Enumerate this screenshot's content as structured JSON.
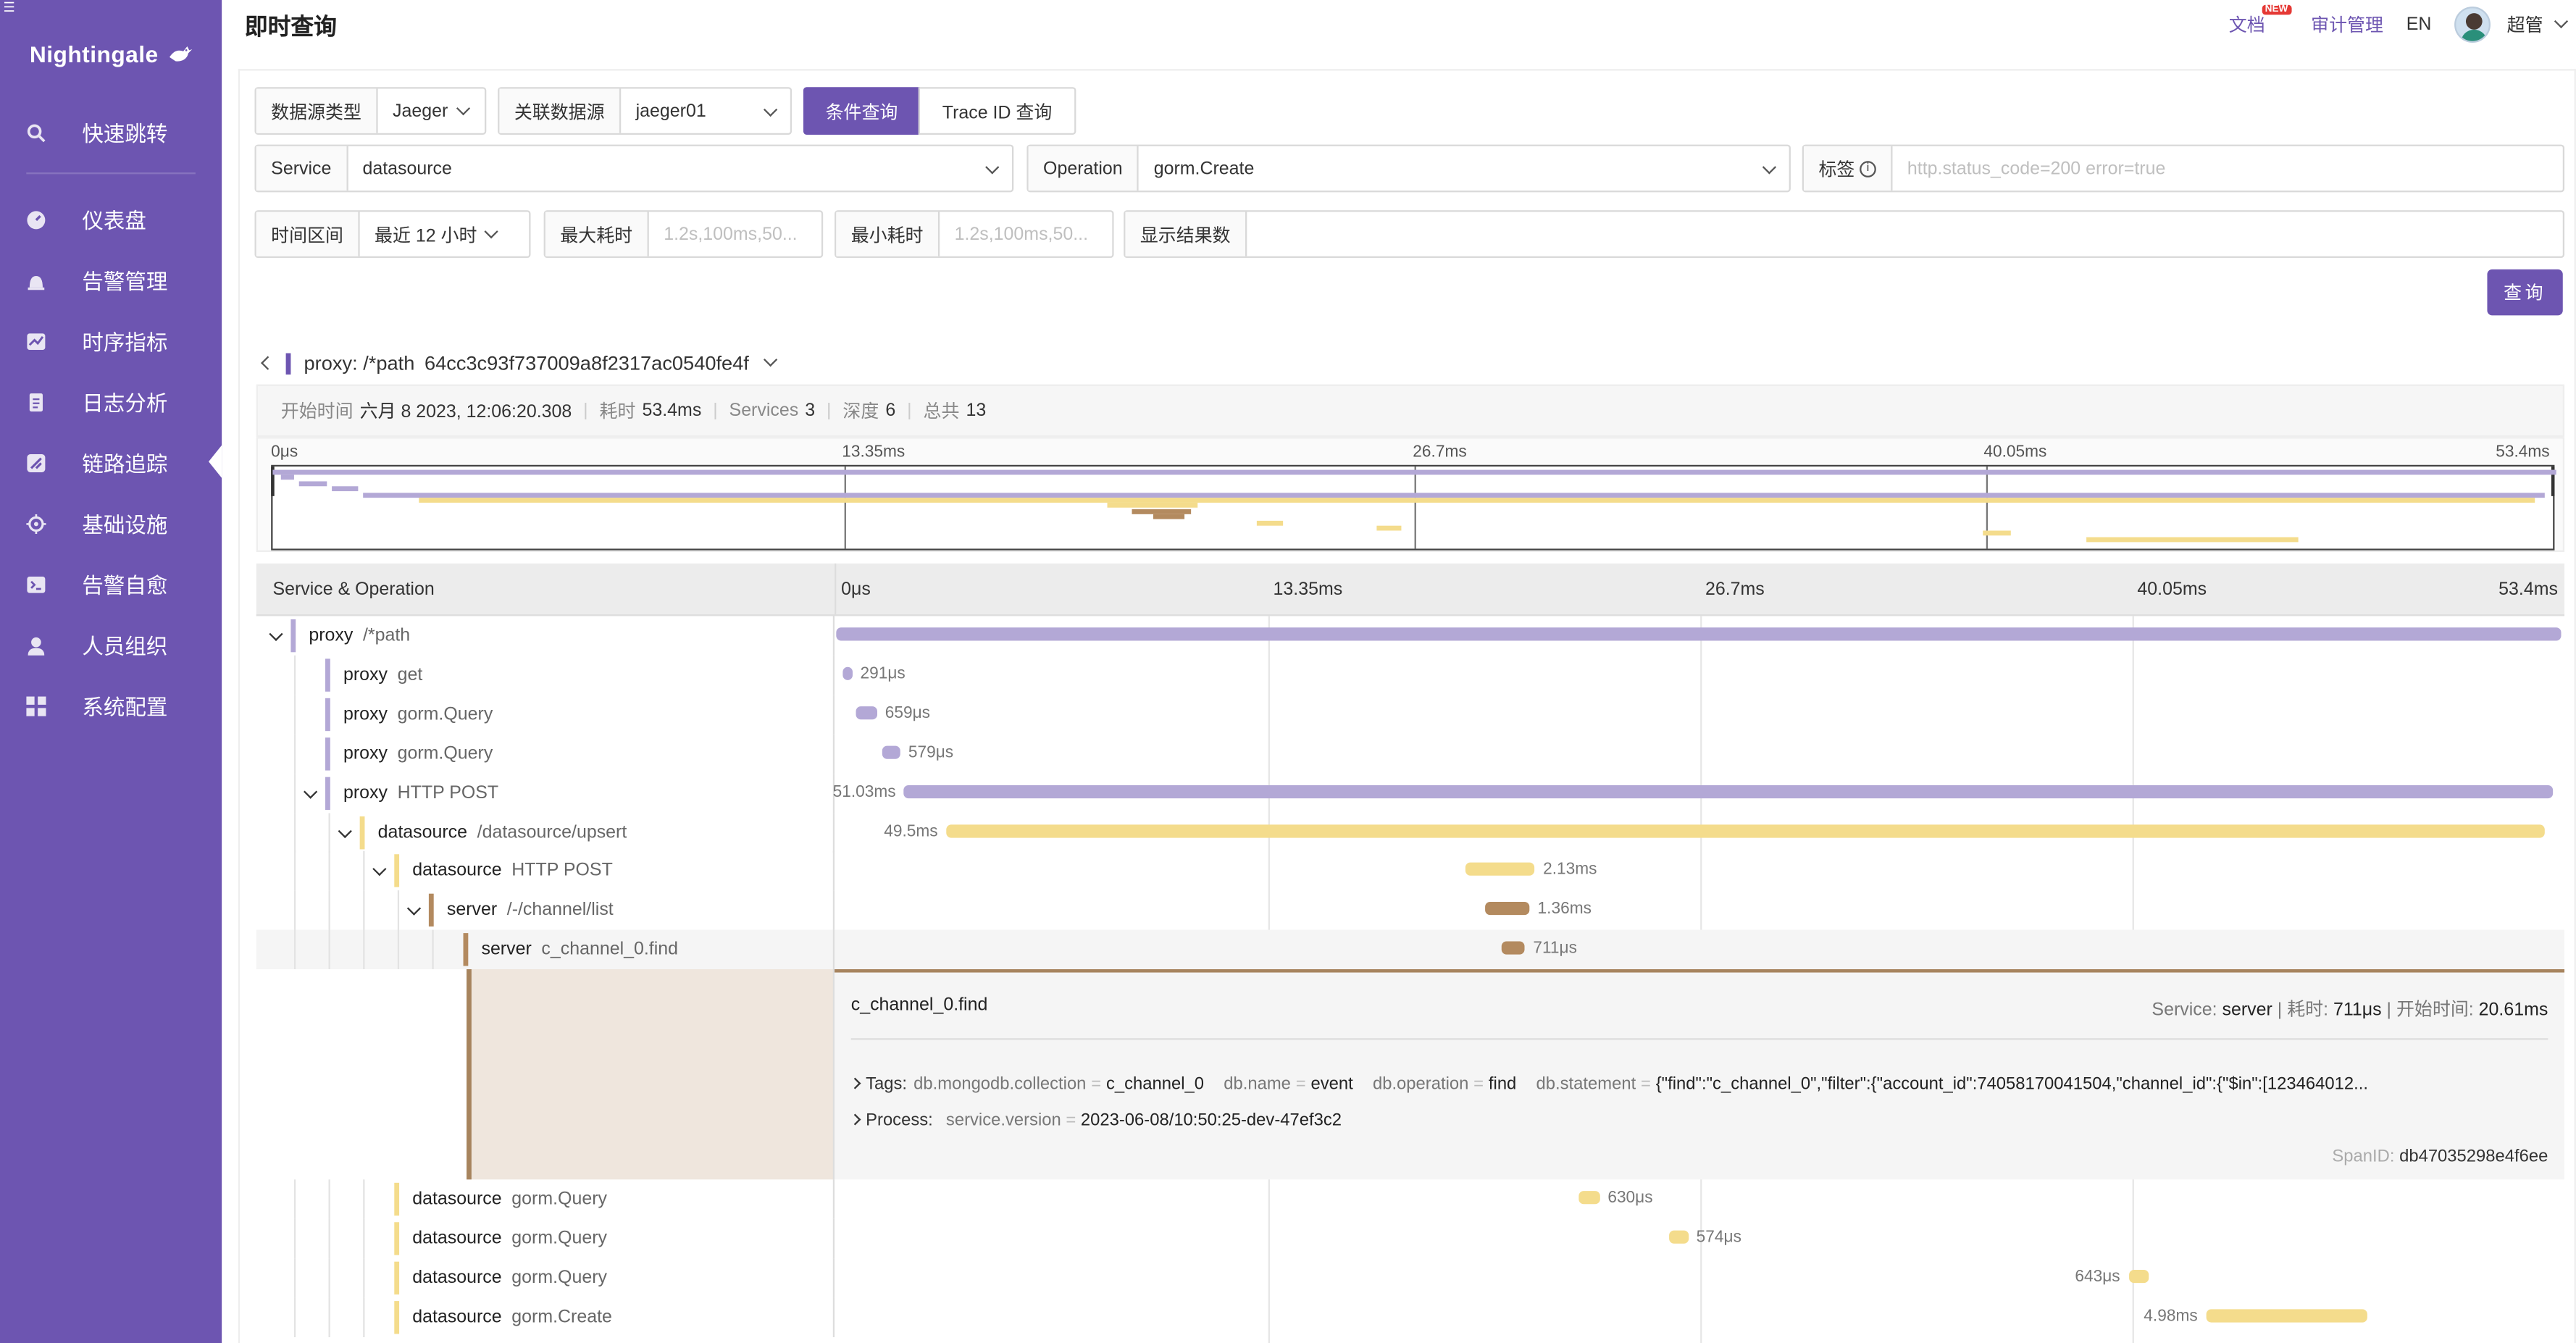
{
  "sidebar": {
    "logo": "Nightingale",
    "items": [
      {
        "label": "快速跳转",
        "icon": "search-icon"
      },
      {
        "label": "仪表盘",
        "icon": "dashboard-icon"
      },
      {
        "label": "告警管理",
        "icon": "alarm-icon"
      },
      {
        "label": "时序指标",
        "icon": "line-chart-icon"
      },
      {
        "label": "日志分析",
        "icon": "document-icon"
      },
      {
        "label": "链路追踪",
        "icon": "trace-icon",
        "active": true
      },
      {
        "label": "基础设施",
        "icon": "crosshair-icon"
      },
      {
        "label": "告警自愈",
        "icon": "terminal-icon"
      },
      {
        "label": "人员组织",
        "icon": "user-icon"
      },
      {
        "label": "系统配置",
        "icon": "grid-icon"
      }
    ]
  },
  "header": {
    "title": "即时查询",
    "docs": "文档",
    "new_badge": "NEW",
    "audit": "审计管理",
    "lang": "EN",
    "user": "超管"
  },
  "filters": {
    "datasource_type_label": "数据源类型",
    "datasource_type_value": "Jaeger",
    "datasource_label": "关联数据源",
    "datasource_value": "jaeger01",
    "tab_condition": "条件查询",
    "tab_traceid": "Trace ID 查询",
    "service_label": "Service",
    "service_value": "datasource",
    "operation_label": "Operation",
    "operation_value": "gorm.Create",
    "tags_label": "标签",
    "tags_placeholder": "http.status_code=200 error=true",
    "time_label": "时间区间",
    "time_value": "最近 12 小时",
    "max_label": "最大耗时",
    "max_placeholder": "1.2s,100ms,50...",
    "min_label": "最小耗时",
    "min_placeholder": "1.2s,100ms,50...",
    "limit_label": "显示结果数",
    "limit_value": "",
    "query_button": "查询"
  },
  "trace": {
    "title": "proxy: /*path",
    "id": "64cc3c93f737009a8f2317ac0540fe4f",
    "start_label": "开始时间",
    "start_value": "六月 8 2023, 12:06:20.308",
    "duration_label": "耗时",
    "duration_value": "53.4ms",
    "services_label": "Services",
    "services_value": "3",
    "depth_label": "深度",
    "depth_value": "6",
    "spans_label": "总共",
    "spans_value": "13",
    "ticks": [
      "0μs",
      "13.35ms",
      "26.7ms",
      "40.05ms",
      "53.4ms"
    ],
    "column_header": "Service & Operation",
    "colors": {
      "proxy": "#b3a8d6",
      "datasource": "#f4dc8c",
      "server": "#b38a5f"
    }
  },
  "spans": [
    {
      "service": "proxy",
      "operation": "/*path",
      "start_ms": 0,
      "duration_ms": 53.4,
      "duration_label": "",
      "depth": 0,
      "expanded": true
    },
    {
      "service": "proxy",
      "operation": "get",
      "start_ms": 0.2,
      "duration_ms": 0.291,
      "duration_label": "291μs",
      "depth": 1
    },
    {
      "service": "proxy",
      "operation": "gorm.Query",
      "start_ms": 0.6,
      "duration_ms": 0.659,
      "duration_label": "659μs",
      "depth": 1
    },
    {
      "service": "proxy",
      "operation": "gorm.Query",
      "start_ms": 1.4,
      "duration_ms": 0.579,
      "duration_label": "579μs",
      "depth": 1
    },
    {
      "service": "proxy",
      "operation": "HTTP POST",
      "start_ms": 2.1,
      "duration_ms": 51.03,
      "duration_label": "51.03ms",
      "depth": 1,
      "expanded": true
    },
    {
      "service": "datasource",
      "operation": "/datasource/upsert",
      "start_ms": 3.4,
      "duration_ms": 49.5,
      "duration_label": "49.5ms",
      "depth": 2,
      "expanded": true
    },
    {
      "service": "datasource",
      "operation": "HTTP POST",
      "start_ms": 19.5,
      "duration_ms": 2.13,
      "duration_label": "2.13ms",
      "depth": 3,
      "expanded": true
    },
    {
      "service": "server",
      "operation": "/-/channel/list",
      "start_ms": 20.1,
      "duration_ms": 1.36,
      "duration_label": "1.36ms",
      "depth": 4,
      "expanded": true
    },
    {
      "service": "server",
      "operation": "c_channel_0.find",
      "start_ms": 20.61,
      "duration_ms": 0.711,
      "duration_label": "711μs",
      "depth": 5,
      "selected": true
    },
    {
      "service": "datasource",
      "operation": "gorm.Query",
      "start_ms": 23.0,
      "duration_ms": 0.63,
      "duration_label": "630μs",
      "depth": 3
    },
    {
      "service": "datasource",
      "operation": "gorm.Query",
      "start_ms": 25.8,
      "duration_ms": 0.574,
      "duration_label": "574μs",
      "depth": 3
    },
    {
      "service": "datasource",
      "operation": "gorm.Query",
      "start_ms": 40.0,
      "duration_ms": 0.643,
      "duration_label": "643μs",
      "depth": 3
    },
    {
      "service": "datasource",
      "operation": "gorm.Create",
      "start_ms": 42.4,
      "duration_ms": 4.98,
      "duration_label": "4.98ms",
      "depth": 3
    }
  ],
  "detail": {
    "name": "c_channel_0.find",
    "service_label": "Service:",
    "service": "server",
    "duration_label": "耗时:",
    "duration": "711μs",
    "start_label": "开始时间:",
    "start": "20.61ms",
    "tags_label": "Tags:",
    "tags": [
      {
        "key": "db.mongodb.collection",
        "value": "c_channel_0"
      },
      {
        "key": "db.name",
        "value": "event"
      },
      {
        "key": "db.operation",
        "value": "find"
      },
      {
        "key": "db.statement",
        "value": "{\"find\":\"c_channel_0\",\"filter\":{\"account_id\":74058170041504,\"channel_id\":{\"$in\":[123464012..."
      }
    ],
    "process_label": "Process:",
    "process": [
      {
        "key": "service.version",
        "value": "2023-06-08/10:50:25-dev-47ef3c2"
      }
    ],
    "spanid_label": "SpanID:",
    "spanid": "db47035298e4f6ee"
  }
}
